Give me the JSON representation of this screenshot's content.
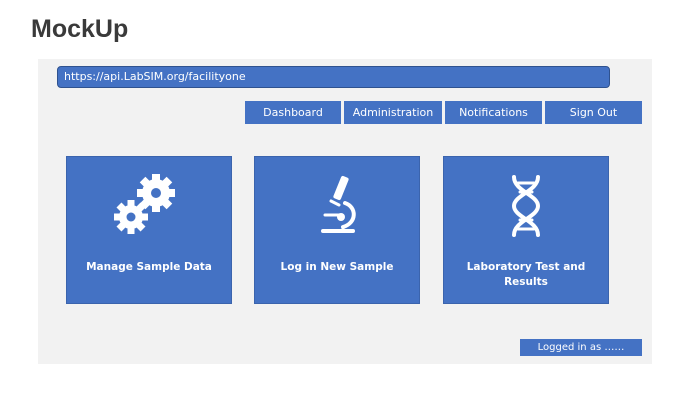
{
  "page_title": "MockUp",
  "url_bar": {
    "value": "https://api.LabSIM.org/facilityone"
  },
  "nav": {
    "items": [
      {
        "label": "Dashboard"
      },
      {
        "label": "Administration"
      },
      {
        "label": "Notifications"
      },
      {
        "label": "Sign Out"
      }
    ]
  },
  "tiles": [
    {
      "label": "Manage Sample Data",
      "icon": "gears-icon"
    },
    {
      "label": "Log in New Sample",
      "icon": "microscope-icon"
    },
    {
      "label": "Laboratory Test and Results",
      "icon": "dna-icon"
    }
  ],
  "status": {
    "logged_in": "Logged in as ……"
  },
  "colors": {
    "accent": "#4472c4",
    "frame_bg": "#f2f2f2",
    "title": "#3a3a3a"
  }
}
